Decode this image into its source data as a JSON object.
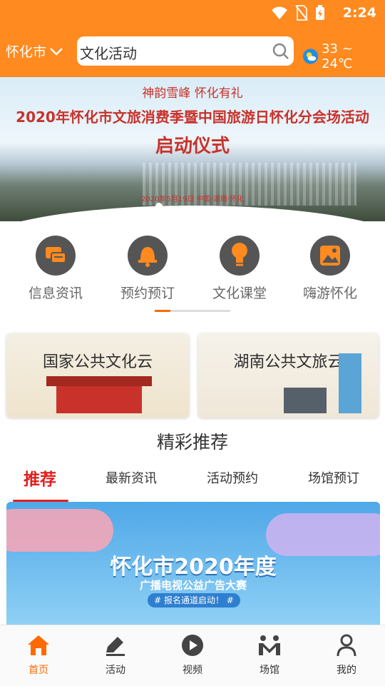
{
  "status_bar": {
    "time": "2:24"
  },
  "header": {
    "city": "怀化市",
    "search_text": "文化活动",
    "weather_text": "33 ~ 24℃"
  },
  "banner": {
    "slogan": "神韵雪峰 怀化有礼",
    "title": "2020年怀化市文旅消费季暨中国旅游日怀化分会场活动",
    "subtitle": "启动仪式",
    "date_line": "2020年5月19日  中国·湖南·怀化"
  },
  "quick_menu": [
    {
      "label": "信息资讯",
      "icon": "message-icon"
    },
    {
      "label": "预约预订",
      "icon": "bell-icon"
    },
    {
      "label": "文化课堂",
      "icon": "lightbulb-icon"
    },
    {
      "label": "嗨游怀化",
      "icon": "picture-icon"
    }
  ],
  "cards": [
    {
      "title": "国家公共文化云"
    },
    {
      "title": "湖南公共文旅云"
    }
  ],
  "section_title": "精彩推荐",
  "tabs": [
    {
      "label": "推荐",
      "active": true
    },
    {
      "label": "最新资讯"
    },
    {
      "label": "活动预约"
    },
    {
      "label": "场馆预订"
    }
  ],
  "recommend_banner": {
    "title": "怀化市2020年度",
    "subtitle": "广播电视公益广告大赛",
    "badge": "# 报名通道启动！ #"
  },
  "bottom_nav": [
    {
      "label": "首页",
      "icon": "home-icon",
      "active": true
    },
    {
      "label": "活动",
      "icon": "edit-icon"
    },
    {
      "label": "视频",
      "icon": "play-icon"
    },
    {
      "label": "场馆",
      "icon": "venue-icon"
    },
    {
      "label": "我的",
      "icon": "user-icon"
    }
  ],
  "colors": {
    "accent": "#ff8a1f",
    "active_tab": "#e02020"
  }
}
